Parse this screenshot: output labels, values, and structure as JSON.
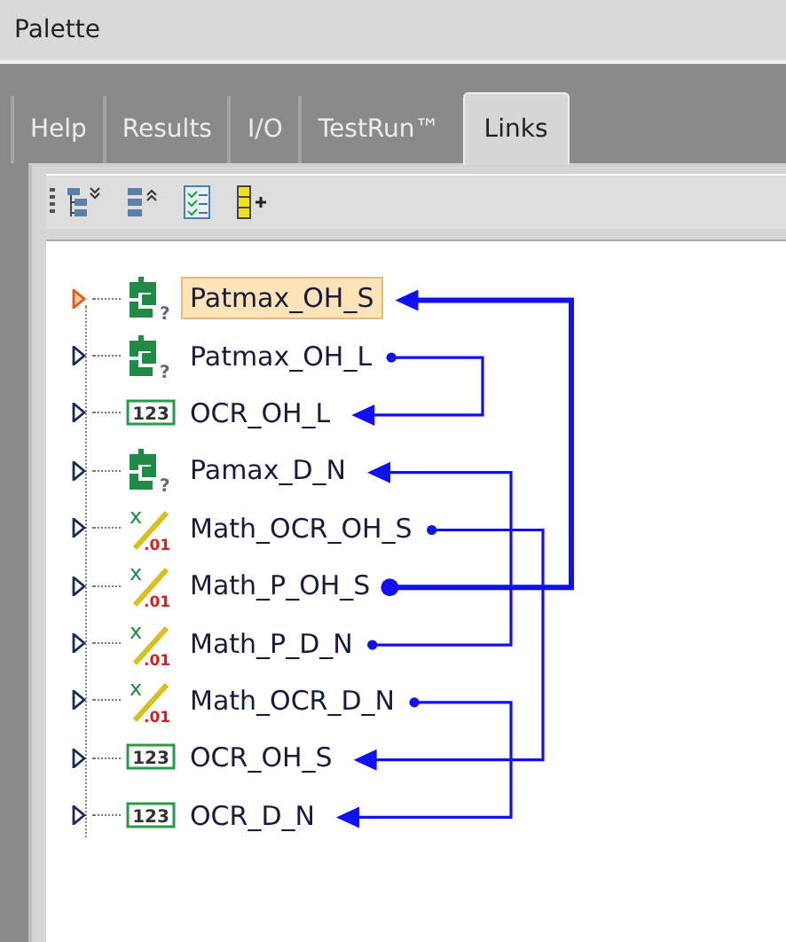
{
  "window": {
    "title": "Palette"
  },
  "tabs": [
    {
      "label": "Help",
      "selected": false
    },
    {
      "label": "Results",
      "selected": false
    },
    {
      "label": "I/O",
      "selected": false
    },
    {
      "label": "TestRun™",
      "selected": false
    },
    {
      "label": "Links",
      "selected": true
    }
  ],
  "toolbar": [
    {
      "kind": "expand"
    },
    {
      "kind": "collapse"
    },
    {
      "kind": "checklist"
    },
    {
      "kind": "add"
    }
  ],
  "tree": {
    "items": [
      {
        "label": "Patmax_OH_S",
        "selected": true,
        "expanded": false,
        "icon": {
          "kind": "pattern",
          "text": "?"
        }
      },
      {
        "label": "Patmax_OH_L",
        "selected": false,
        "expanded": false,
        "icon": {
          "kind": "pattern",
          "text": "?"
        }
      },
      {
        "label": "OCR_OH_L",
        "selected": false,
        "expanded": false,
        "icon": {
          "kind": "ocr",
          "text": "123"
        }
      },
      {
        "label": "Pamax_D_N",
        "selected": false,
        "expanded": false,
        "icon": {
          "kind": "pattern",
          "text": "?"
        }
      },
      {
        "label": "Math_OCR_OH_S",
        "selected": false,
        "expanded": false,
        "icon": {
          "kind": "math",
          "text": "x",
          "sub": ".01"
        }
      },
      {
        "label": "Math_P_OH_S",
        "selected": false,
        "expanded": false,
        "icon": {
          "kind": "math",
          "text": "x",
          "sub": ".01"
        }
      },
      {
        "label": "Math_P_D_N",
        "selected": false,
        "expanded": false,
        "icon": {
          "kind": "math",
          "text": "x",
          "sub": ".01"
        }
      },
      {
        "label": "Math_OCR_D_N",
        "selected": false,
        "expanded": false,
        "icon": {
          "kind": "math",
          "text": "x",
          "sub": ".01"
        }
      },
      {
        "label": "OCR_OH_S",
        "selected": false,
        "expanded": false,
        "icon": {
          "kind": "ocr",
          "text": "123"
        }
      },
      {
        "label": "OCR_D_N",
        "selected": false,
        "expanded": false,
        "icon": {
          "kind": "ocr",
          "text": "123"
        }
      }
    ],
    "links": [
      {
        "selected": true
      },
      {
        "selected": false
      },
      {
        "selected": false
      },
      {
        "selected": false
      },
      {
        "selected": false
      }
    ]
  }
}
